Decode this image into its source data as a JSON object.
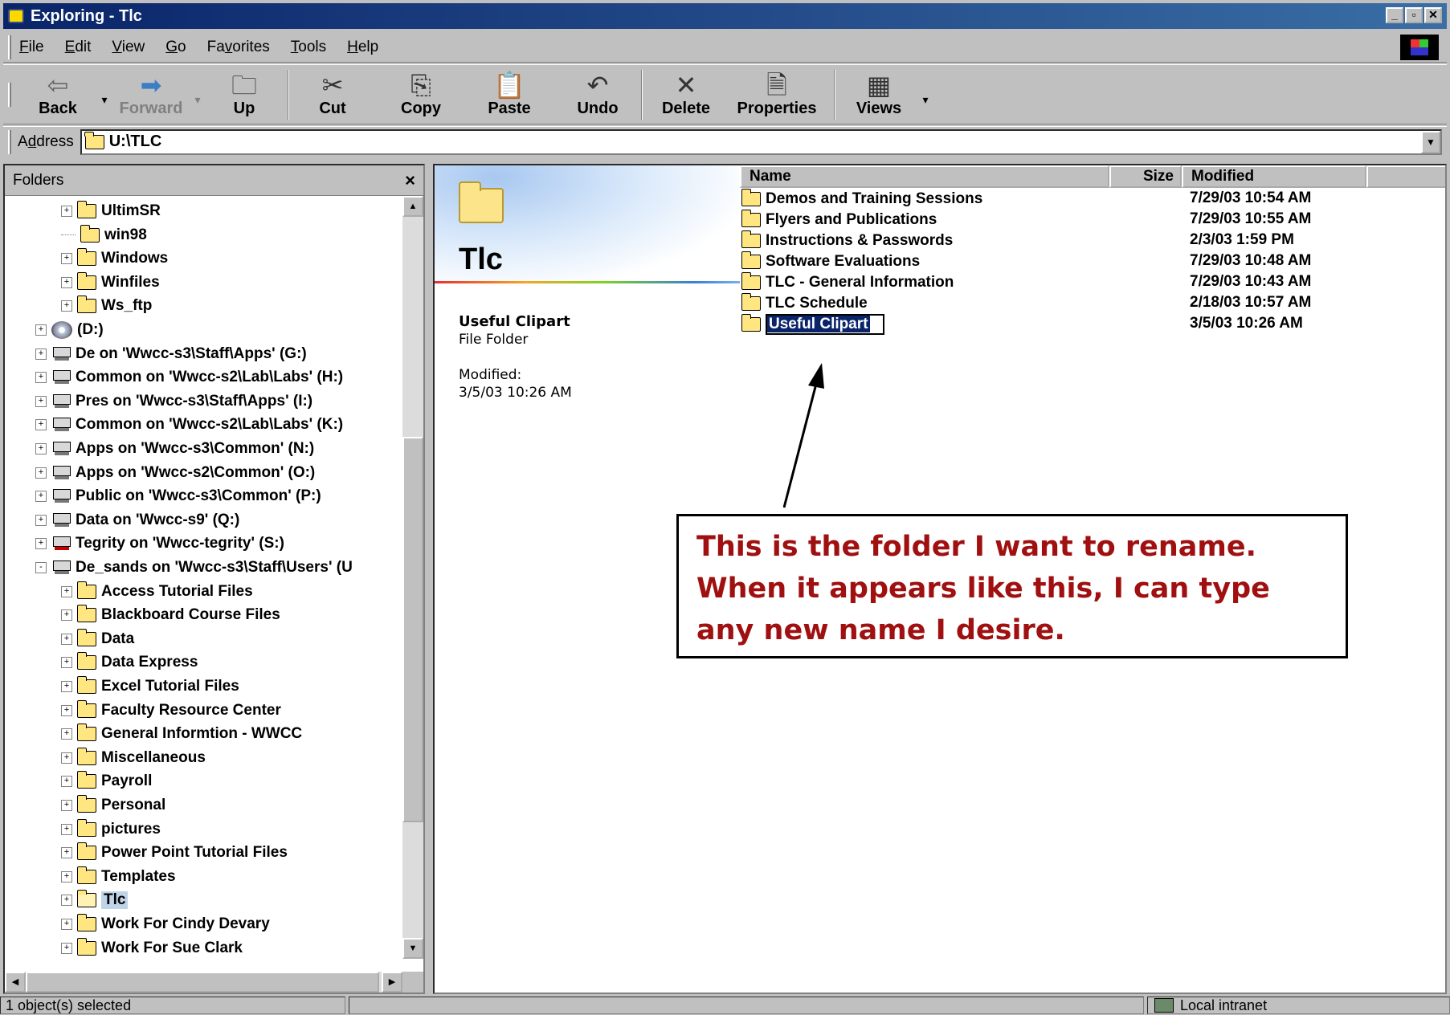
{
  "window": {
    "title": "Exploring - Tlc",
    "min": "_",
    "max": "▫",
    "close": "✕"
  },
  "menus": [
    {
      "u": "F",
      "rest": "ile"
    },
    {
      "u": "E",
      "rest": "dit"
    },
    {
      "u": "V",
      "rest": "iew"
    },
    {
      "u": "G",
      "rest": "o"
    },
    {
      "pre": "Fa",
      "u": "v",
      "rest": "orites"
    },
    {
      "u": "T",
      "rest": "ools"
    },
    {
      "u": "H",
      "rest": "elp"
    }
  ],
  "toolbar": {
    "back": "Back",
    "forward": "Forward",
    "up": "Up",
    "cut": "Cut",
    "copy": "Copy",
    "paste": "Paste",
    "undo": "Undo",
    "delete": "Delete",
    "properties": "Properties",
    "views": "Views"
  },
  "address": {
    "label_pre": "A",
    "label_u": "d",
    "label_rest": "dress",
    "value": "U:\\TLC"
  },
  "folders": {
    "title": "Folders",
    "close": "×",
    "tree": [
      {
        "label": "UltimSR",
        "type": "folder",
        "level": 2,
        "pm": "+"
      },
      {
        "label": "win98",
        "type": "folder",
        "level": 2,
        "pm": ""
      },
      {
        "label": "Windows",
        "type": "folder",
        "level": 2,
        "pm": "+"
      },
      {
        "label": "Winfiles",
        "type": "folder",
        "level": 2,
        "pm": "+"
      },
      {
        "label": "Ws_ftp",
        "type": "folder",
        "level": 2,
        "pm": "+"
      },
      {
        "label": "(D:)",
        "type": "cd",
        "level": 1,
        "pm": "+"
      },
      {
        "label": "De on 'Wwcc-s3\\Staff\\Apps' (G:)",
        "type": "drive",
        "level": 1,
        "pm": "+"
      },
      {
        "label": "Common on 'Wwcc-s2\\Lab\\Labs' (H:)",
        "type": "drive",
        "level": 1,
        "pm": "+"
      },
      {
        "label": "Pres on 'Wwcc-s3\\Staff\\Apps' (I:)",
        "type": "drive",
        "level": 1,
        "pm": "+"
      },
      {
        "label": "Common on 'Wwcc-s2\\Lab\\Labs' (K:)",
        "type": "drive",
        "level": 1,
        "pm": "+"
      },
      {
        "label": "Apps on 'Wwcc-s3\\Common' (N:)",
        "type": "drive",
        "level": 1,
        "pm": "+"
      },
      {
        "label": "Apps on 'Wwcc-s2\\Common' (O:)",
        "type": "drive",
        "level": 1,
        "pm": "+"
      },
      {
        "label": "Public on 'Wwcc-s3\\Common' (P:)",
        "type": "drive",
        "level": 1,
        "pm": "+"
      },
      {
        "label": "Data on 'Wwcc-s9' (Q:)",
        "type": "drive",
        "level": 1,
        "pm": "+"
      },
      {
        "label": "Tegrity on 'Wwcc-tegrity' (S:)",
        "type": "drive-bad",
        "level": 1,
        "pm": "+"
      },
      {
        "label": "De_sands on 'Wwcc-s3\\Staff\\Users' (U",
        "type": "drive",
        "level": 1,
        "pm": "-"
      },
      {
        "label": "Access Tutorial Files",
        "type": "folder",
        "level": 2,
        "pm": "+"
      },
      {
        "label": "Blackboard Course Files",
        "type": "folder",
        "level": 2,
        "pm": "+"
      },
      {
        "label": "Data",
        "type": "folder",
        "level": 2,
        "pm": "+"
      },
      {
        "label": "Data Express",
        "type": "folder",
        "level": 2,
        "pm": "+"
      },
      {
        "label": "Excel Tutorial Files",
        "type": "folder",
        "level": 2,
        "pm": "+"
      },
      {
        "label": "Faculty Resource Center",
        "type": "folder",
        "level": 2,
        "pm": "+"
      },
      {
        "label": "General Informtion - WWCC",
        "type": "folder",
        "level": 2,
        "pm": "+"
      },
      {
        "label": "Miscellaneous",
        "type": "folder",
        "level": 2,
        "pm": "+"
      },
      {
        "label": "Payroll",
        "type": "folder",
        "level": 2,
        "pm": "+"
      },
      {
        "label": "Personal",
        "type": "folder",
        "level": 2,
        "pm": "+"
      },
      {
        "label": "pictures",
        "type": "folder",
        "level": 2,
        "pm": "+"
      },
      {
        "label": "Power Point Tutorial Files",
        "type": "folder",
        "level": 2,
        "pm": "+"
      },
      {
        "label": "Templates",
        "type": "folder",
        "level": 2,
        "pm": "+"
      },
      {
        "label": "Tlc",
        "type": "folder-open",
        "level": 2,
        "pm": "+",
        "selected": true
      },
      {
        "label": "Work For Cindy Devary",
        "type": "folder",
        "level": 2,
        "pm": "+"
      },
      {
        "label": "Work For Sue Clark",
        "type": "folder",
        "level": 2,
        "pm": "+"
      }
    ]
  },
  "webview": {
    "title": "Tlc",
    "sel_name": "Useful Clipart",
    "sel_type": "File Folder",
    "modified_label": "Modified:",
    "modified_value": "3/5/03 10:26 AM"
  },
  "list": {
    "headers": {
      "name": "Name",
      "size": "Size",
      "modified": "Modified"
    },
    "rows": [
      {
        "name": "Demos and Training Sessions",
        "modified": "7/29/03 10:54 AM"
      },
      {
        "name": "Flyers and Publications",
        "modified": "7/29/03 10:55 AM"
      },
      {
        "name": "Instructions & Passwords",
        "modified": "2/3/03 1:59 PM"
      },
      {
        "name": "Software Evaluations",
        "modified": "7/29/03 10:48 AM"
      },
      {
        "name": "TLC - General Information",
        "modified": "7/29/03 10:43 AM"
      },
      {
        "name": "TLC Schedule",
        "modified": "2/18/03 10:57 AM"
      },
      {
        "name": "Useful Clipart",
        "modified": "3/5/03 10:26 AM",
        "editing": true
      }
    ]
  },
  "callout": {
    "text": "This is the folder I want to rename. When it appears like this, I can type any new name I desire."
  },
  "status": {
    "left": "1 object(s) selected",
    "zone": "Local intranet"
  }
}
